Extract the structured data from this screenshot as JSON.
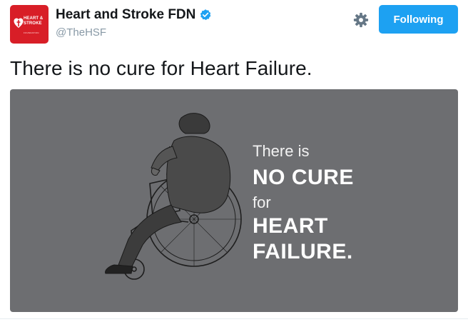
{
  "account": {
    "display_name": "Heart and Stroke FDN",
    "handle": "@TheHSF",
    "verified": true,
    "avatar_text": "HEART & STROKE",
    "avatar_subtext": "FOUNDATION"
  },
  "actions": {
    "follow_label": "Following",
    "settings_icon": "gear-icon"
  },
  "tweet": {
    "text": "There is no cure for Heart Failure."
  },
  "media": {
    "line1": "There is",
    "line2": "NO CURE",
    "line3": "for",
    "line4": "HEART",
    "line5": "FAILURE."
  },
  "colors": {
    "brand_red": "#d81e27",
    "follow_blue": "#1da1f2",
    "verified_blue": "#1da1f2",
    "media_bg": "#6d6e71",
    "handle_gray": "#8899a6"
  }
}
